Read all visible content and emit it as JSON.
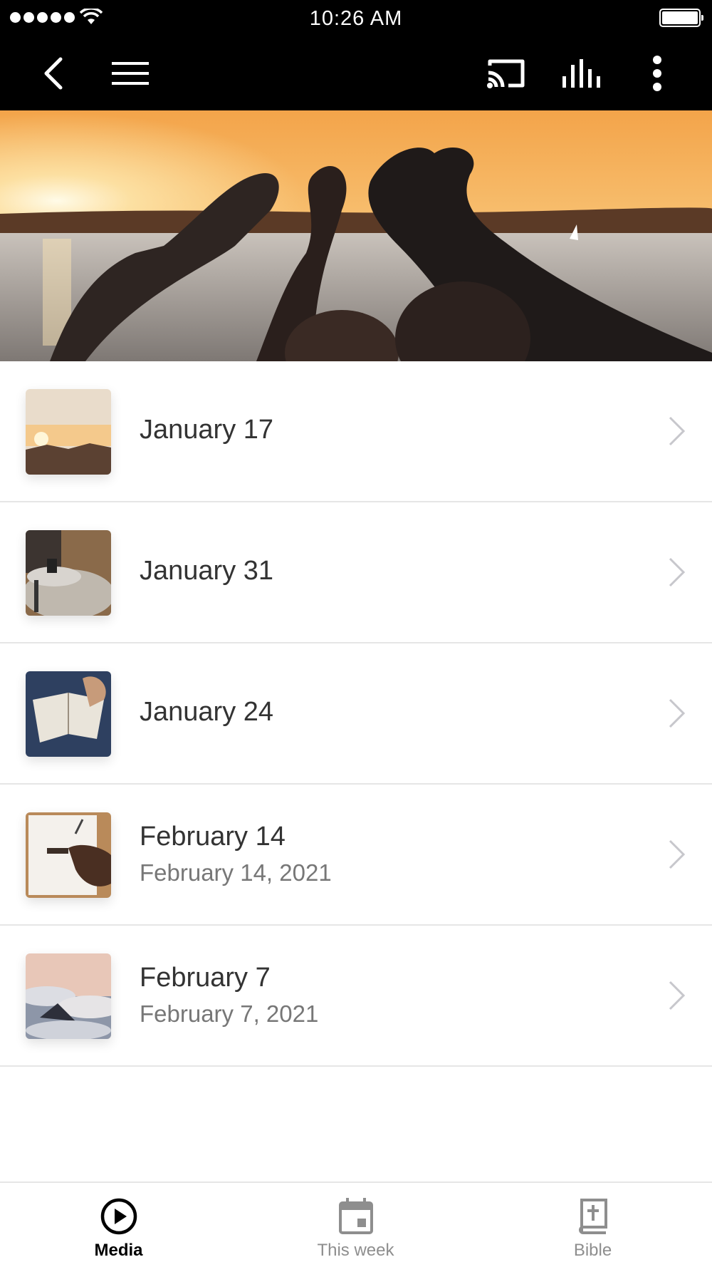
{
  "status_bar": {
    "time": "10:26 AM",
    "signal_bars": 5,
    "battery_level": 1.0
  },
  "nav_bar": {
    "left_icons": [
      "back-chevron-icon",
      "hamburger-menu-icon"
    ],
    "right_icons": [
      "cast-icon",
      "audio-bars-icon",
      "more-vertical-icon"
    ]
  },
  "hero": {
    "image": "sunset-lake-heart-hands"
  },
  "list": {
    "items": [
      {
        "title": "January 17",
        "subtitle": "",
        "thumbnail": "sunrise-mountain"
      },
      {
        "title": "January 31",
        "subtitle": "",
        "thumbnail": "coffee-table"
      },
      {
        "title": "January 24",
        "subtitle": "",
        "thumbnail": "open-bible"
      },
      {
        "title": "February 14",
        "subtitle": "February 14, 2021",
        "thumbnail": "notebook-writing"
      },
      {
        "title": "February 7",
        "subtitle": "February 7, 2021",
        "thumbnail": "clouds-peaks"
      }
    ]
  },
  "tabs": [
    {
      "label": "Media",
      "icon": "play-circle-icon",
      "active": true
    },
    {
      "label": "This week",
      "icon": "calendar-icon",
      "active": false
    },
    {
      "label": "Bible",
      "icon": "bible-icon",
      "active": false
    }
  ],
  "colors": {
    "bar_background": "#000000",
    "title_text": "#333333",
    "subtitle_text": "#777777",
    "divider": "#e6e6e6",
    "tab_inactive": "#8e8e8e"
  }
}
